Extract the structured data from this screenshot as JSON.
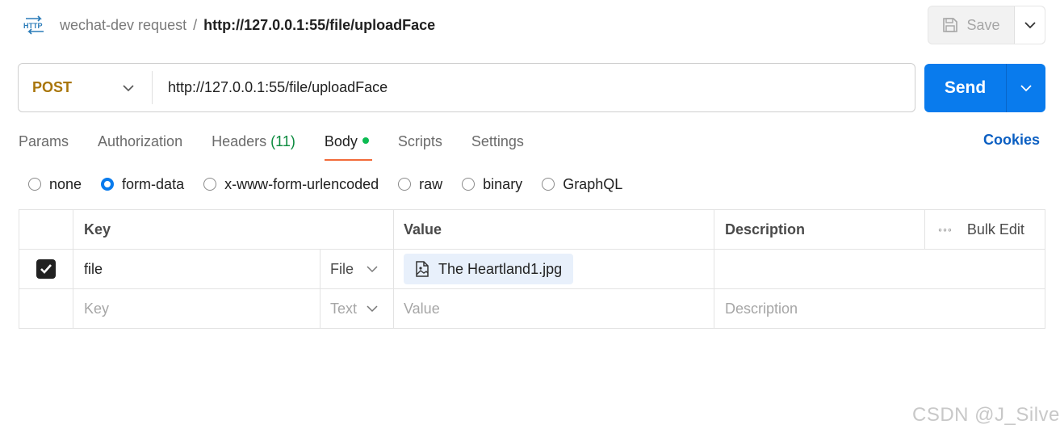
{
  "header": {
    "collection": "wechat-dev request",
    "separator": "/",
    "request_name": "http://127.0.0.1:55/file/uploadFace",
    "save_label": "Save"
  },
  "request": {
    "method": "POST",
    "url": "http://127.0.0.1:55/file/uploadFace",
    "send_label": "Send"
  },
  "tabs": [
    {
      "label": "Params"
    },
    {
      "label": "Authorization"
    },
    {
      "label": "Headers",
      "count": "(11)"
    },
    {
      "label": "Body",
      "active": true
    },
    {
      "label": "Scripts"
    },
    {
      "label": "Settings"
    }
  ],
  "cookies_label": "Cookies",
  "body_types": [
    {
      "label": "none",
      "selected": false
    },
    {
      "label": "form-data",
      "selected": true
    },
    {
      "label": "x-www-form-urlencoded",
      "selected": false
    },
    {
      "label": "raw",
      "selected": false
    },
    {
      "label": "binary",
      "selected": false
    },
    {
      "label": "GraphQL",
      "selected": false
    }
  ],
  "table": {
    "headers": {
      "key": "Key",
      "value": "Value",
      "description": "Description",
      "bulk_edit": "Bulk Edit"
    },
    "rows": [
      {
        "checked": true,
        "key": "file",
        "type": "File",
        "value": "The Heartland1.jpg",
        "description": ""
      }
    ],
    "new_row": {
      "key_placeholder": "Key",
      "type": "Text",
      "value_placeholder": "Value",
      "description_placeholder": "Description"
    }
  },
  "watermark": "CSDN @J_Silver",
  "colors": {
    "accent": "#097bed",
    "method": "#a9760a",
    "tab_indicator": "#f26b3a",
    "body_dot": "#0cbb52",
    "cookies": "#0b5fc2"
  }
}
